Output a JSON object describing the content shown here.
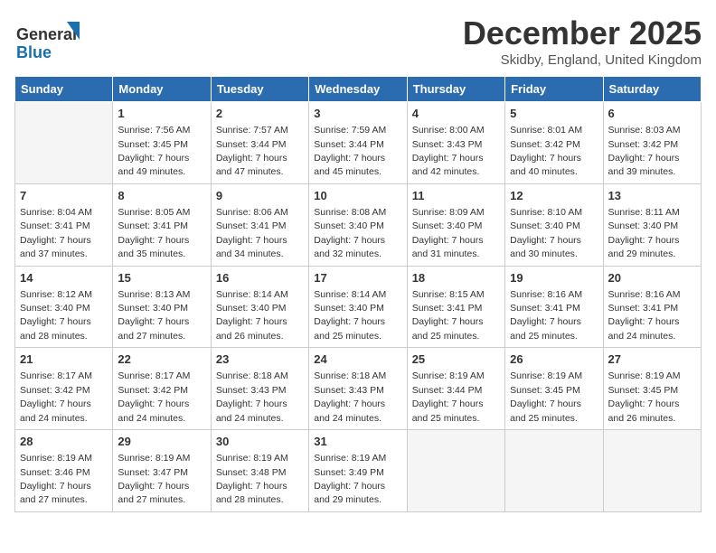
{
  "logo": {
    "line1": "General",
    "line2": "Blue"
  },
  "header": {
    "month": "December 2025",
    "location": "Skidby, England, United Kingdom"
  },
  "days_of_week": [
    "Sunday",
    "Monday",
    "Tuesday",
    "Wednesday",
    "Thursday",
    "Friday",
    "Saturday"
  ],
  "weeks": [
    [
      {
        "day": "",
        "empty": true
      },
      {
        "day": "1",
        "sunrise": "7:56 AM",
        "sunset": "3:45 PM",
        "daylight": "7 hours and 49 minutes."
      },
      {
        "day": "2",
        "sunrise": "7:57 AM",
        "sunset": "3:44 PM",
        "daylight": "7 hours and 47 minutes."
      },
      {
        "day": "3",
        "sunrise": "7:59 AM",
        "sunset": "3:44 PM",
        "daylight": "7 hours and 45 minutes."
      },
      {
        "day": "4",
        "sunrise": "8:00 AM",
        "sunset": "3:43 PM",
        "daylight": "7 hours and 42 minutes."
      },
      {
        "day": "5",
        "sunrise": "8:01 AM",
        "sunset": "3:42 PM",
        "daylight": "7 hours and 40 minutes."
      },
      {
        "day": "6",
        "sunrise": "8:03 AM",
        "sunset": "3:42 PM",
        "daylight": "7 hours and 39 minutes."
      }
    ],
    [
      {
        "day": "7",
        "sunrise": "8:04 AM",
        "sunset": "3:41 PM",
        "daylight": "7 hours and 37 minutes."
      },
      {
        "day": "8",
        "sunrise": "8:05 AM",
        "sunset": "3:41 PM",
        "daylight": "7 hours and 35 minutes."
      },
      {
        "day": "9",
        "sunrise": "8:06 AM",
        "sunset": "3:41 PM",
        "daylight": "7 hours and 34 minutes."
      },
      {
        "day": "10",
        "sunrise": "8:08 AM",
        "sunset": "3:40 PM",
        "daylight": "7 hours and 32 minutes."
      },
      {
        "day": "11",
        "sunrise": "8:09 AM",
        "sunset": "3:40 PM",
        "daylight": "7 hours and 31 minutes."
      },
      {
        "day": "12",
        "sunrise": "8:10 AM",
        "sunset": "3:40 PM",
        "daylight": "7 hours and 30 minutes."
      },
      {
        "day": "13",
        "sunrise": "8:11 AM",
        "sunset": "3:40 PM",
        "daylight": "7 hours and 29 minutes."
      }
    ],
    [
      {
        "day": "14",
        "sunrise": "8:12 AM",
        "sunset": "3:40 PM",
        "daylight": "7 hours and 28 minutes."
      },
      {
        "day": "15",
        "sunrise": "8:13 AM",
        "sunset": "3:40 PM",
        "daylight": "7 hours and 27 minutes."
      },
      {
        "day": "16",
        "sunrise": "8:14 AM",
        "sunset": "3:40 PM",
        "daylight": "7 hours and 26 minutes."
      },
      {
        "day": "17",
        "sunrise": "8:14 AM",
        "sunset": "3:40 PM",
        "daylight": "7 hours and 25 minutes."
      },
      {
        "day": "18",
        "sunrise": "8:15 AM",
        "sunset": "3:41 PM",
        "daylight": "7 hours and 25 minutes."
      },
      {
        "day": "19",
        "sunrise": "8:16 AM",
        "sunset": "3:41 PM",
        "daylight": "7 hours and 25 minutes."
      },
      {
        "day": "20",
        "sunrise": "8:16 AM",
        "sunset": "3:41 PM",
        "daylight": "7 hours and 24 minutes."
      }
    ],
    [
      {
        "day": "21",
        "sunrise": "8:17 AM",
        "sunset": "3:42 PM",
        "daylight": "7 hours and 24 minutes."
      },
      {
        "day": "22",
        "sunrise": "8:17 AM",
        "sunset": "3:42 PM",
        "daylight": "7 hours and 24 minutes."
      },
      {
        "day": "23",
        "sunrise": "8:18 AM",
        "sunset": "3:43 PM",
        "daylight": "7 hours and 24 minutes."
      },
      {
        "day": "24",
        "sunrise": "8:18 AM",
        "sunset": "3:43 PM",
        "daylight": "7 hours and 24 minutes."
      },
      {
        "day": "25",
        "sunrise": "8:19 AM",
        "sunset": "3:44 PM",
        "daylight": "7 hours and 25 minutes."
      },
      {
        "day": "26",
        "sunrise": "8:19 AM",
        "sunset": "3:45 PM",
        "daylight": "7 hours and 25 minutes."
      },
      {
        "day": "27",
        "sunrise": "8:19 AM",
        "sunset": "3:45 PM",
        "daylight": "7 hours and 26 minutes."
      }
    ],
    [
      {
        "day": "28",
        "sunrise": "8:19 AM",
        "sunset": "3:46 PM",
        "daylight": "7 hours and 27 minutes."
      },
      {
        "day": "29",
        "sunrise": "8:19 AM",
        "sunset": "3:47 PM",
        "daylight": "7 hours and 27 minutes."
      },
      {
        "day": "30",
        "sunrise": "8:19 AM",
        "sunset": "3:48 PM",
        "daylight": "7 hours and 28 minutes."
      },
      {
        "day": "31",
        "sunrise": "8:19 AM",
        "sunset": "3:49 PM",
        "daylight": "7 hours and 29 minutes."
      },
      {
        "day": "",
        "empty": true
      },
      {
        "day": "",
        "empty": true
      },
      {
        "day": "",
        "empty": true
      }
    ]
  ],
  "labels": {
    "sunrise": "Sunrise:",
    "sunset": "Sunset:",
    "daylight": "Daylight:"
  }
}
